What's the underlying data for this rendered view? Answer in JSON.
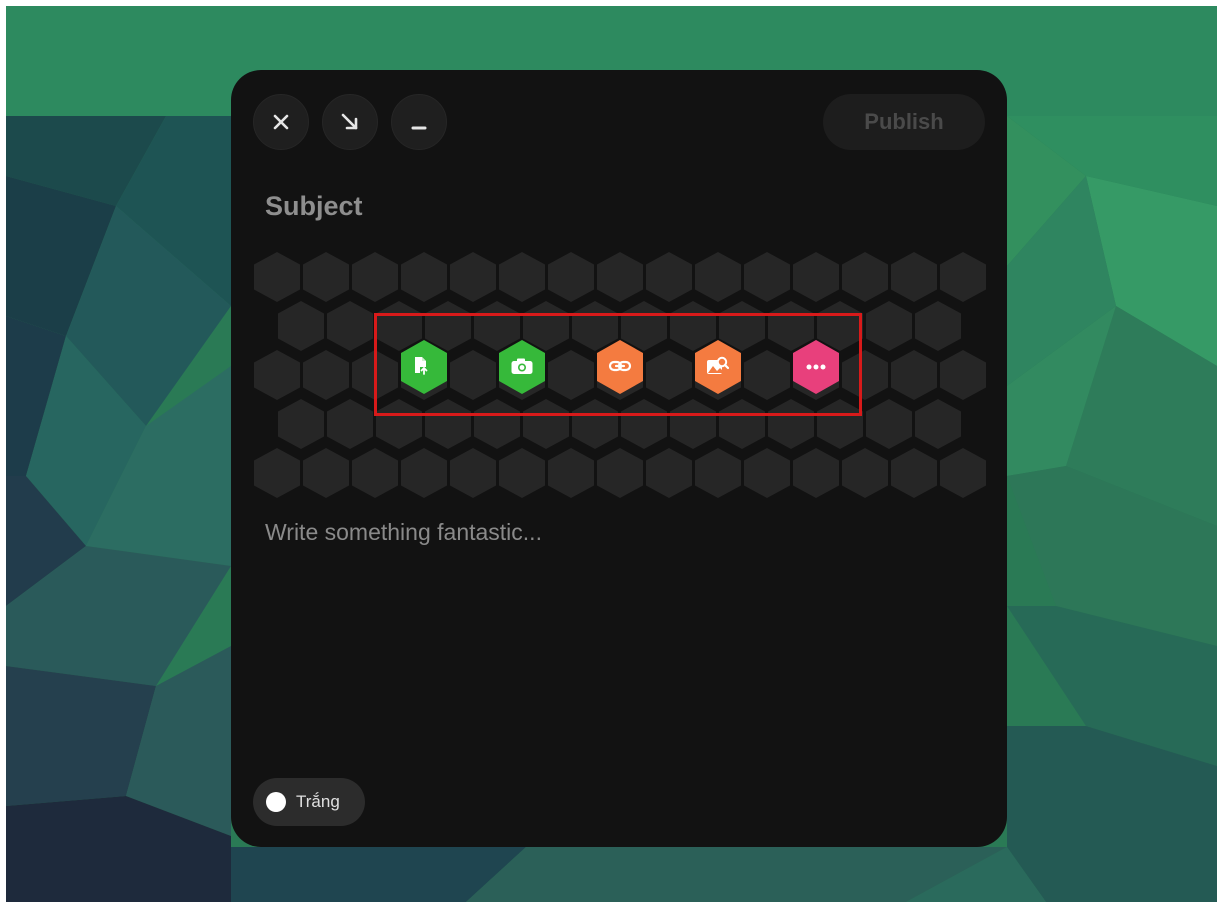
{
  "colors": {
    "panel": "#121212",
    "hex_cell": "#262626",
    "green": "#36b93a",
    "orange": "#f47b40",
    "pink": "#e8407c",
    "highlight": "#d81a1a",
    "background_top": "#2d8a5f"
  },
  "window_controls": [
    {
      "name": "close-button",
      "icon": "close-icon"
    },
    {
      "name": "shrink-button",
      "icon": "arrow-down-right-icon"
    },
    {
      "name": "minimize-button",
      "icon": "minimize-icon"
    }
  ],
  "publish_label": "Publish",
  "subject_placeholder": "Subject",
  "body_placeholder": "Write something fantastic...",
  "tools": [
    {
      "name": "file-upload",
      "icon": "file-upload-icon",
      "color": "green"
    },
    {
      "name": "camera",
      "icon": "camera-icon",
      "color": "green"
    },
    {
      "name": "link",
      "icon": "link-icon",
      "color": "orange"
    },
    {
      "name": "image-search",
      "icon": "image-search-icon",
      "color": "orange"
    },
    {
      "name": "more",
      "icon": "more-dots-icon",
      "color": "pink"
    }
  ],
  "theme_toggle": {
    "label": "Trắng"
  }
}
